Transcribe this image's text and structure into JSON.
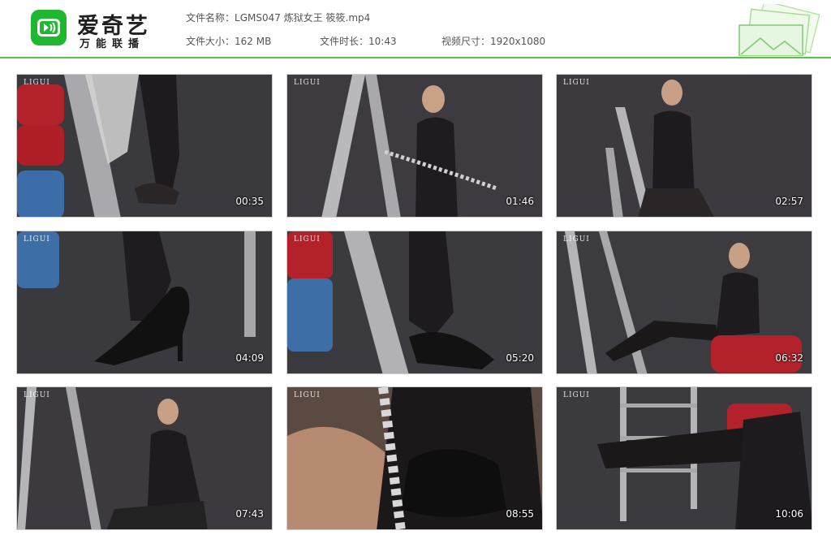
{
  "header": {
    "logo_name": "爱奇艺",
    "logo_sub": "万能联播",
    "file_name_label": "文件名称：",
    "file_name": "LGMS047 炼狱女王 筱筱.mp4",
    "file_size_label": "文件大小：",
    "file_size": "162 MB",
    "duration_label": "文件时长：",
    "duration": "10:43",
    "resolution_label": "视频尺寸：",
    "resolution": "1920x1080"
  },
  "colors": {
    "accent": "#5ac24a",
    "logo_green": "#1fb630"
  },
  "thumbnails": [
    {
      "timestamp": "00:35",
      "brand": "LIGUI"
    },
    {
      "timestamp": "01:46",
      "brand": "LIGUI"
    },
    {
      "timestamp": "02:57",
      "brand": "LIGUI"
    },
    {
      "timestamp": "04:09",
      "brand": "LIGUI"
    },
    {
      "timestamp": "05:20",
      "brand": "LIGUI"
    },
    {
      "timestamp": "06:32",
      "brand": "LIGUI"
    },
    {
      "timestamp": "07:43",
      "brand": "LIGUI"
    },
    {
      "timestamp": "08:55",
      "brand": "LIGUI"
    },
    {
      "timestamp": "10:06",
      "brand": "LIGUI"
    }
  ]
}
